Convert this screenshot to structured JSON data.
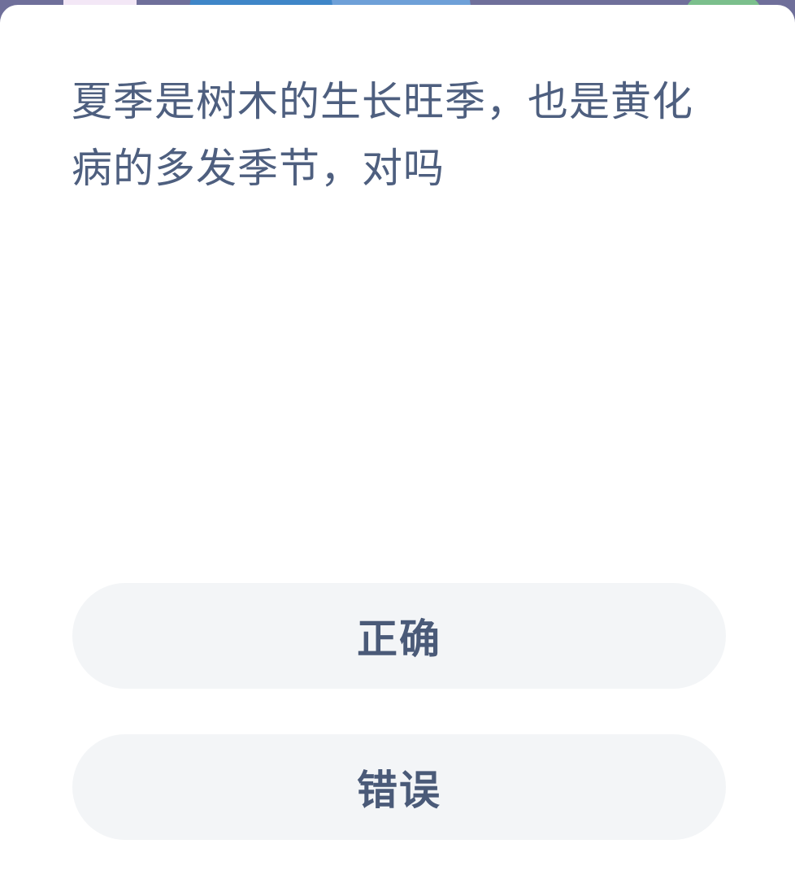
{
  "quiz": {
    "question": "夏季是树木的生长旺季，也是黄化病的多发季节，对吗",
    "options": [
      {
        "label": "正确"
      },
      {
        "label": "错误"
      }
    ]
  },
  "colors": {
    "question_text": "#4e5f7f",
    "option_bg": "#f3f5f7",
    "option_text": "#4a5a78",
    "banner": "#6f6f9a"
  }
}
